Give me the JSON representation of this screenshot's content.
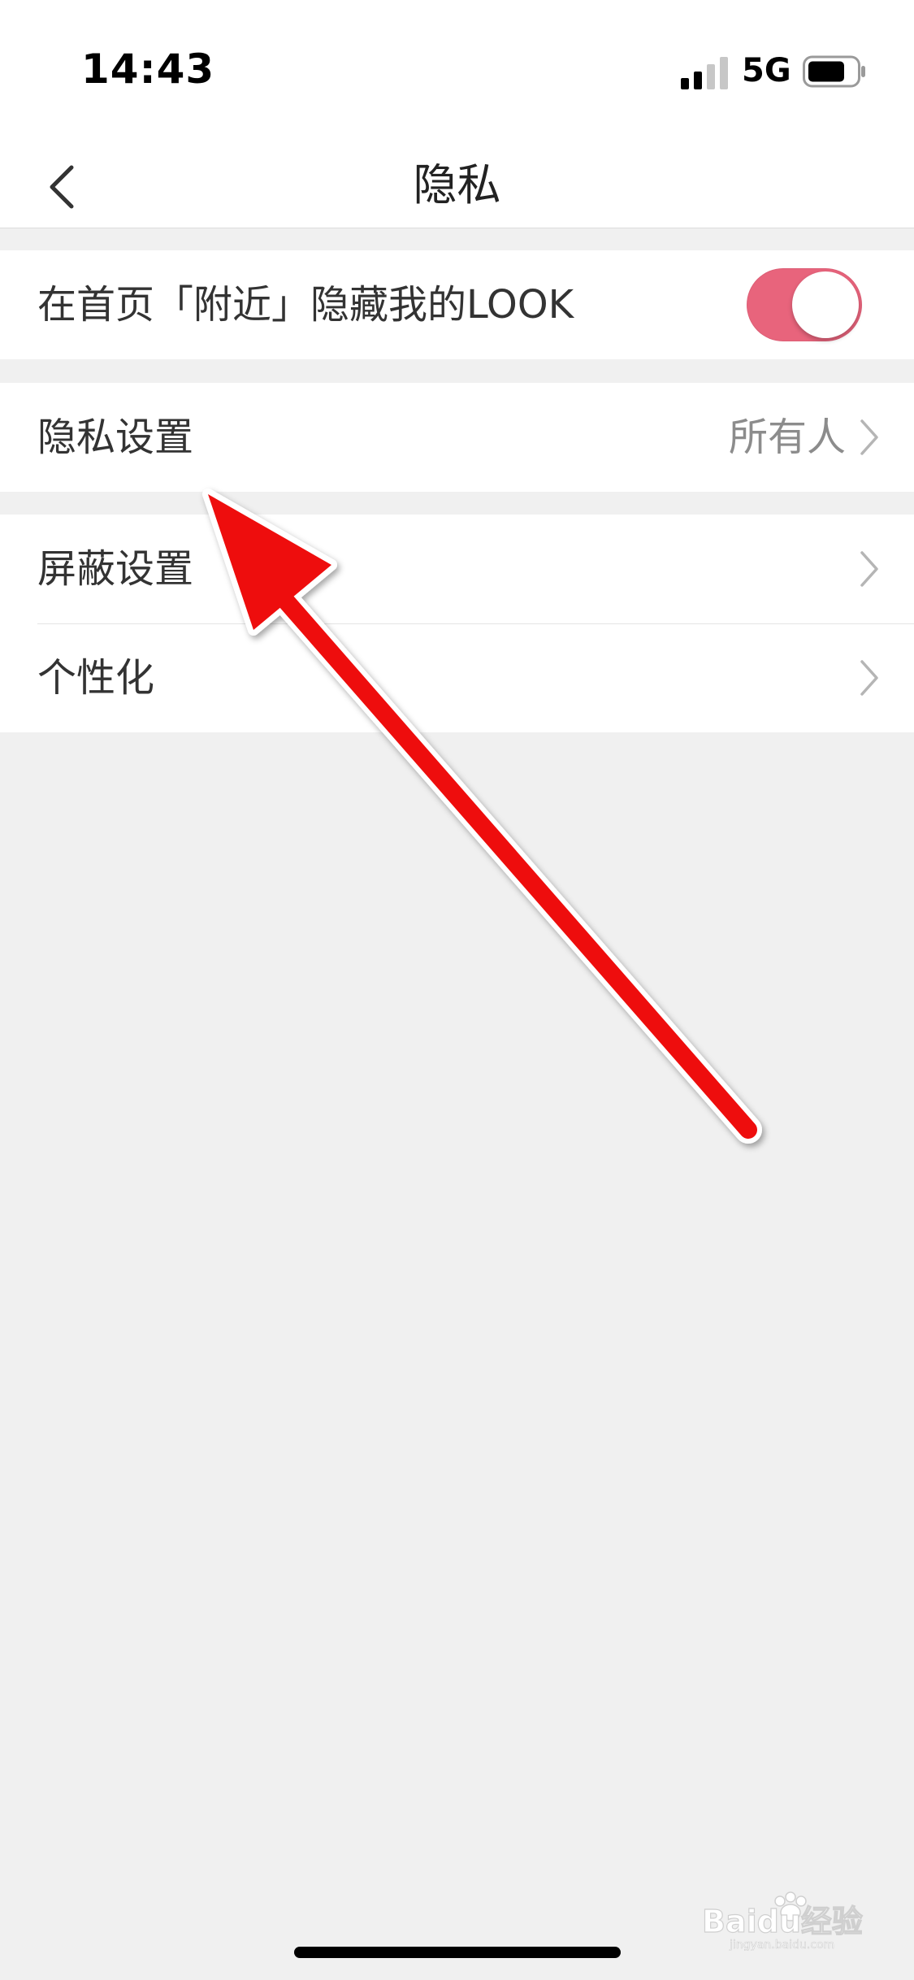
{
  "status_bar": {
    "time": "14:43",
    "network": "5G"
  },
  "nav": {
    "title": "隐私",
    "back_icon": "chevron-left-icon"
  },
  "rows": {
    "nearby_hide": {
      "label": "在首页「附近」隐藏我的LOOK",
      "toggle_on": true,
      "toggle_color": "#e8647c"
    },
    "privacy_settings": {
      "label": "隐私设置",
      "value": "所有人"
    },
    "block_settings": {
      "label": "屏蔽设置"
    },
    "personalization": {
      "label": "个性化"
    }
  },
  "annotation": {
    "type": "arrow",
    "color": "#ee0a0a"
  },
  "watermark": {
    "brand": "Baidu经验",
    "url": "jingyan.baidu.com"
  }
}
